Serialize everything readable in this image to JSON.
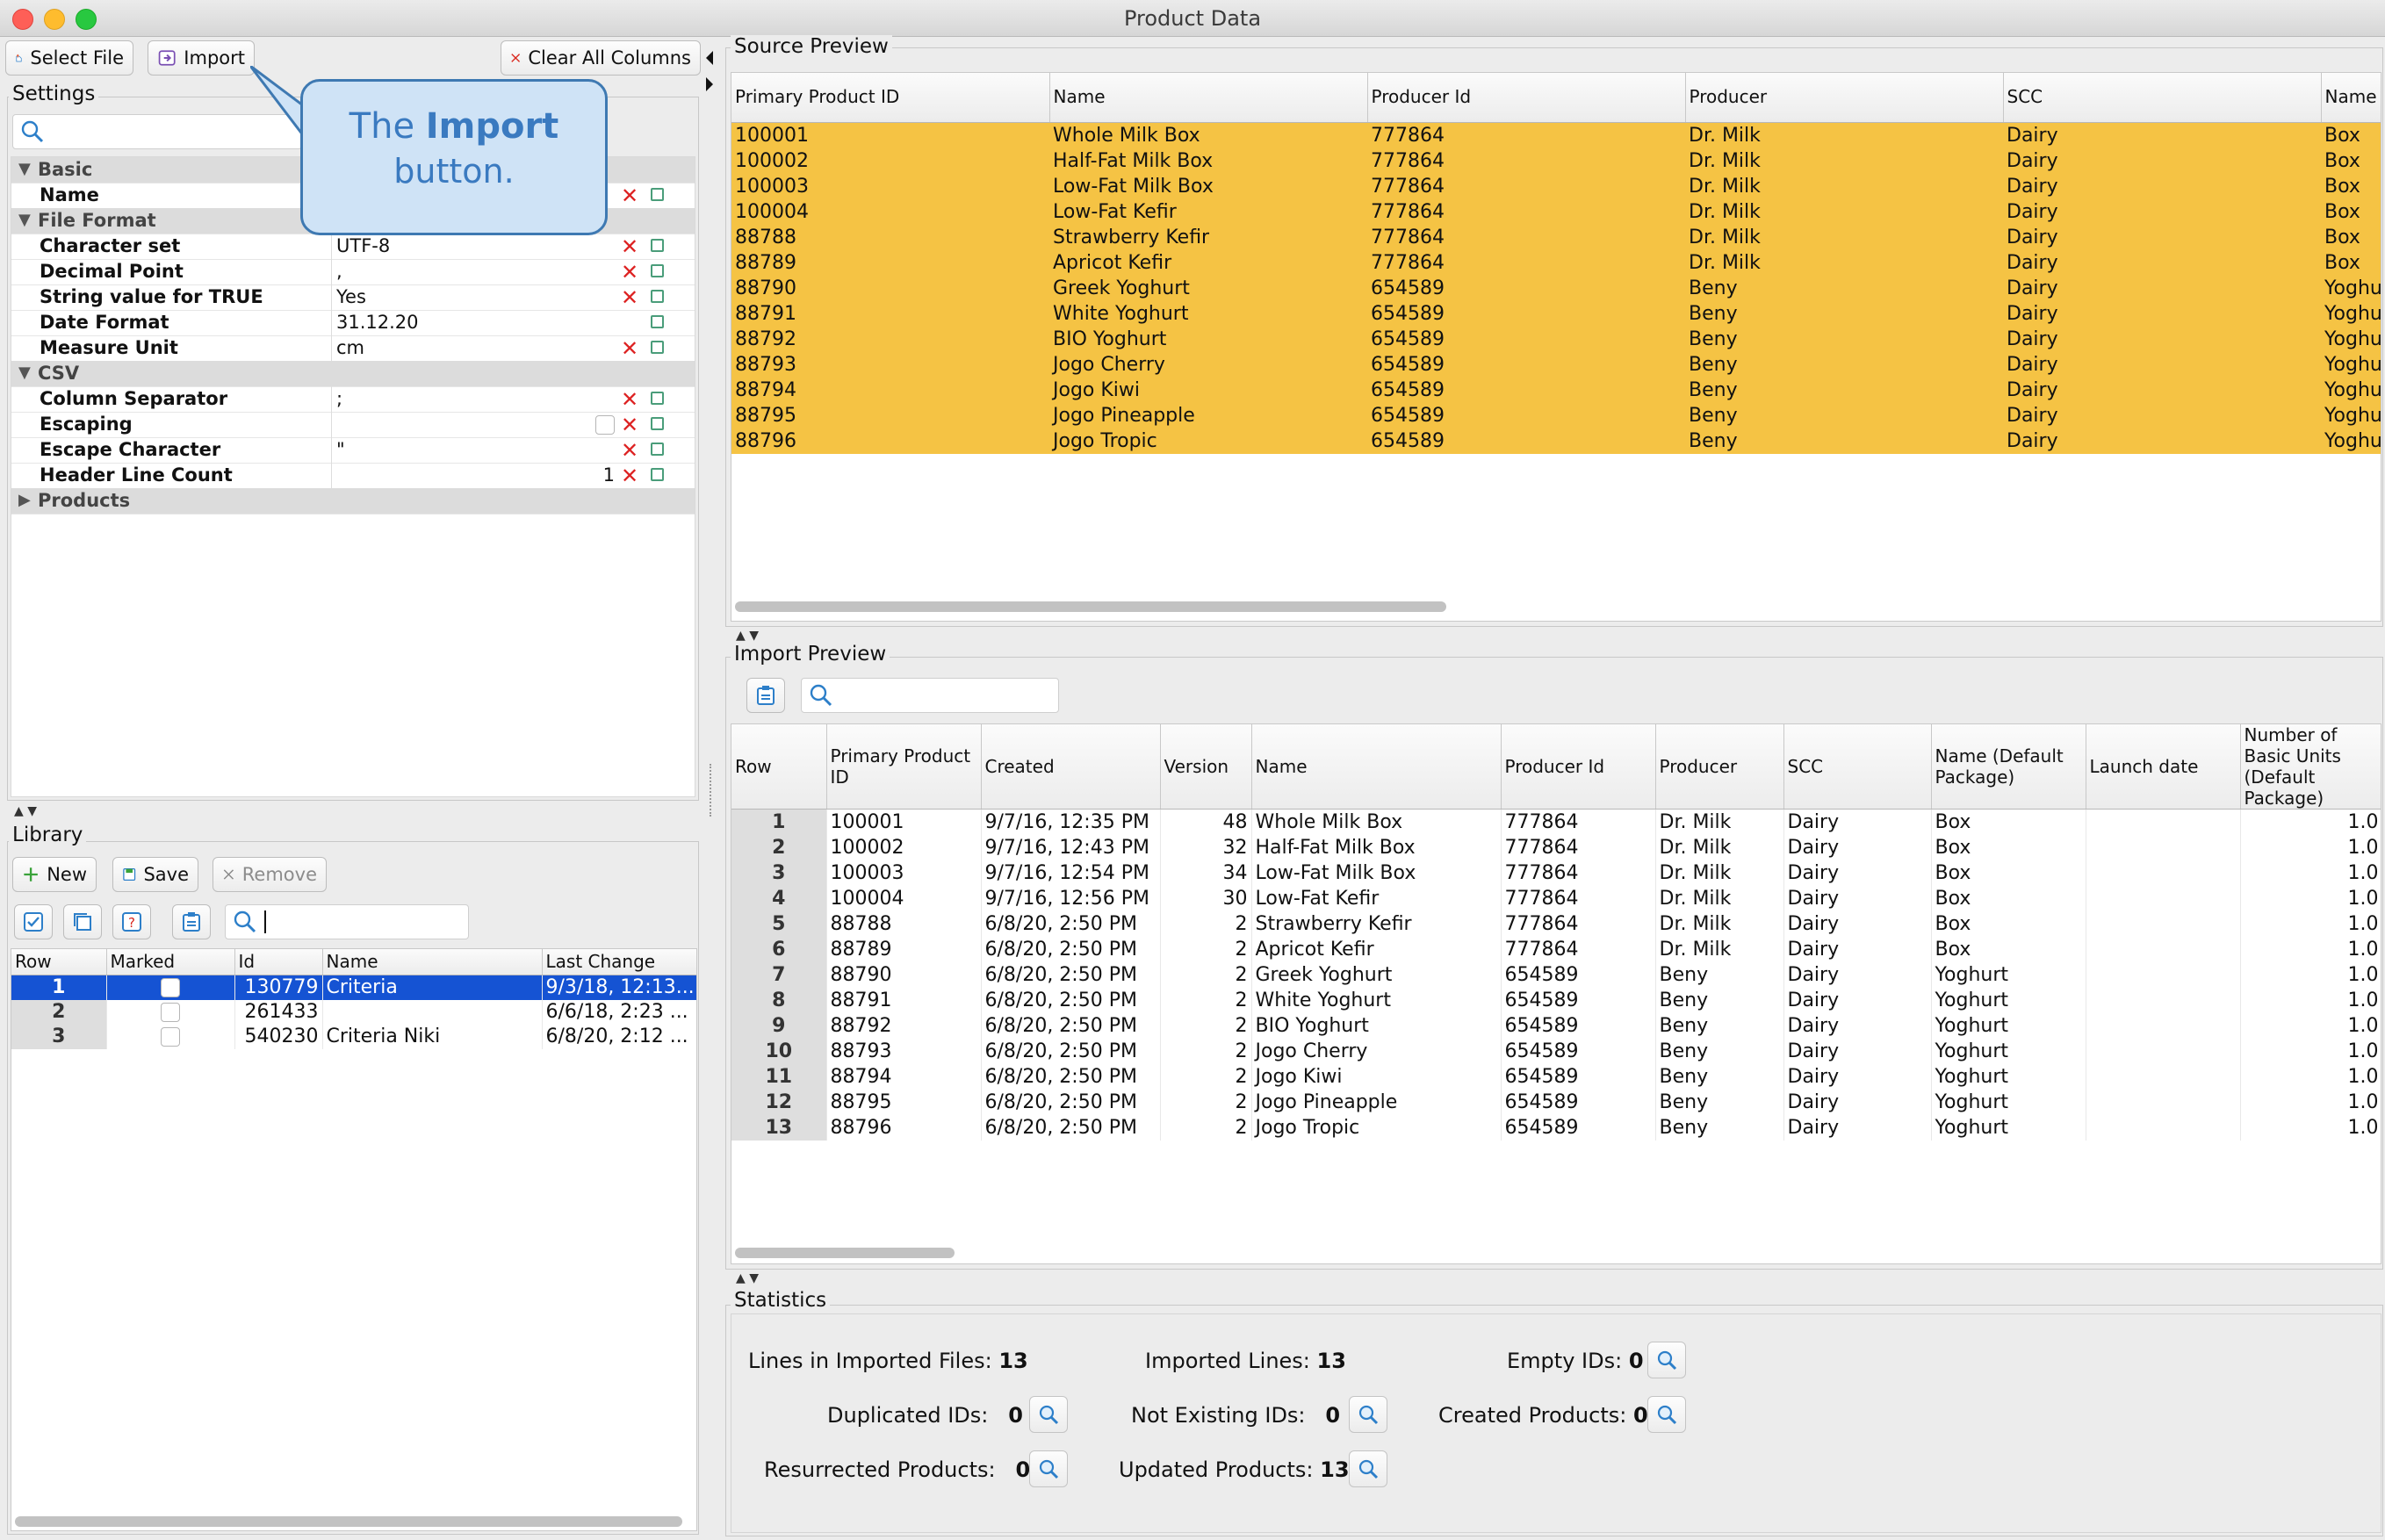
{
  "window": {
    "title": "Product Data"
  },
  "toolbar": {
    "select_file": "Select File",
    "import": "Import",
    "clear_all_columns": "Clear All Columns"
  },
  "settings": {
    "section_label": "Settings",
    "search_placeholder": "",
    "rows": [
      {
        "type": "group",
        "label": "Basic"
      },
      {
        "type": "prop",
        "label": "Name",
        "value": "",
        "clear": true
      },
      {
        "type": "group",
        "label": "File Format"
      },
      {
        "type": "prop",
        "label": "Character set",
        "value": "UTF-8",
        "clear": true
      },
      {
        "type": "prop",
        "label": "Decimal Point",
        "value": ",",
        "clear": true
      },
      {
        "type": "prop",
        "label": "String value for TRUE",
        "value": "Yes",
        "clear": true
      },
      {
        "type": "prop",
        "label": "Date Format",
        "value": "31.12.20",
        "clear": false
      },
      {
        "type": "prop",
        "label": "Measure Unit",
        "value": "cm",
        "clear": true
      },
      {
        "type": "group",
        "label": "CSV"
      },
      {
        "type": "prop",
        "label": "Column Separator",
        "value": ";",
        "clear": true
      },
      {
        "type": "prop",
        "label": "Escaping",
        "value": "",
        "checkbox": true,
        "clear": true
      },
      {
        "type": "prop",
        "label": "Escape Character",
        "value": "\"",
        "clear": true
      },
      {
        "type": "prop",
        "label": "Header Line Count",
        "value": "1",
        "align": "right",
        "clear": true
      },
      {
        "type": "group",
        "label": "Products",
        "collapsed": true
      }
    ]
  },
  "callout": {
    "prefix": "The ",
    "bold": "Import",
    "line2": "button."
  },
  "library": {
    "section_label": "Library",
    "new_label": "New",
    "save_label": "Save",
    "remove_label": "Remove",
    "search_value": "",
    "columns": [
      "Row",
      "Marked",
      "Id",
      "Name",
      "Last Change"
    ],
    "rows": [
      {
        "row": "1",
        "id": "130779",
        "name": "Criteria",
        "last_change": "9/3/18, 12:13...",
        "selected": true
      },
      {
        "row": "2",
        "id": "261433",
        "name": "",
        "last_change": "6/6/18, 2:23 ...",
        "selected": false
      },
      {
        "row": "3",
        "id": "540230",
        "name": "Criteria Niki",
        "last_change": "6/8/20, 2:12 ...",
        "selected": false
      }
    ]
  },
  "source_preview": {
    "section_label": "Source Preview",
    "highlight_color": "#f5c344",
    "columns": [
      "Primary Product ID",
      "Name",
      "Producer Id",
      "Producer",
      "SCC",
      "Name"
    ],
    "rows": [
      [
        "100001",
        "Whole Milk Box",
        "777864",
        "Dr. Milk",
        "Dairy",
        "Box"
      ],
      [
        "100002",
        "Half-Fat Milk Box",
        "777864",
        "Dr. Milk",
        "Dairy",
        "Box"
      ],
      [
        "100003",
        "Low-Fat Milk Box",
        "777864",
        "Dr. Milk",
        "Dairy",
        "Box"
      ],
      [
        "100004",
        "Low-Fat Kefir",
        "777864",
        "Dr. Milk",
        "Dairy",
        "Box"
      ],
      [
        "88788",
        "Strawberry Kefir",
        "777864",
        "Dr. Milk",
        "Dairy",
        "Box"
      ],
      [
        "88789",
        "Apricot Kefir",
        "777864",
        "Dr. Milk",
        "Dairy",
        "Box"
      ],
      [
        "88790",
        "Greek Yoghurt",
        "654589",
        "Beny",
        "Dairy",
        "Yoghu"
      ],
      [
        "88791",
        "White Yoghurt",
        "654589",
        "Beny",
        "Dairy",
        "Yoghu"
      ],
      [
        "88792",
        "BIO Yoghurt",
        "654589",
        "Beny",
        "Dairy",
        "Yoghu"
      ],
      [
        "88793",
        "Jogo Cherry",
        "654589",
        "Beny",
        "Dairy",
        "Yoghu"
      ],
      [
        "88794",
        "Jogo Kiwi",
        "654589",
        "Beny",
        "Dairy",
        "Yoghu"
      ],
      [
        "88795",
        "Jogo Pineapple",
        "654589",
        "Beny",
        "Dairy",
        "Yoghu"
      ],
      [
        "88796",
        "Jogo Tropic",
        "654589",
        "Beny",
        "Dairy",
        "Yoghu"
      ]
    ]
  },
  "import_preview": {
    "section_label": "Import Preview",
    "search_value": "",
    "columns": [
      "Row",
      "Primary Product ID",
      "Created",
      "Version",
      "Name",
      "Producer Id",
      "Producer",
      "SCC",
      "Name (Default Package)",
      "Launch date",
      "Number of Basic Units (Default Package)"
    ],
    "rows": [
      [
        "1",
        "100001",
        "9/7/16, 12:35 PM",
        "48",
        "Whole Milk Box",
        "777864",
        "Dr. Milk",
        "Dairy",
        "Box",
        "",
        "1.0"
      ],
      [
        "2",
        "100002",
        "9/7/16, 12:43 PM",
        "32",
        "Half-Fat Milk Box",
        "777864",
        "Dr. Milk",
        "Dairy",
        "Box",
        "",
        "1.0"
      ],
      [
        "3",
        "100003",
        "9/7/16, 12:54 PM",
        "34",
        "Low-Fat Milk Box",
        "777864",
        "Dr. Milk",
        "Dairy",
        "Box",
        "",
        "1.0"
      ],
      [
        "4",
        "100004",
        "9/7/16, 12:56 PM",
        "30",
        "Low-Fat Kefir",
        "777864",
        "Dr. Milk",
        "Dairy",
        "Box",
        "",
        "1.0"
      ],
      [
        "5",
        "88788",
        "6/8/20, 2:50 PM",
        "2",
        "Strawberry Kefir",
        "777864",
        "Dr. Milk",
        "Dairy",
        "Box",
        "",
        "1.0"
      ],
      [
        "6",
        "88789",
        "6/8/20, 2:50 PM",
        "2",
        "Apricot Kefir",
        "777864",
        "Dr. Milk",
        "Dairy",
        "Box",
        "",
        "1.0"
      ],
      [
        "7",
        "88790",
        "6/8/20, 2:50 PM",
        "2",
        "Greek Yoghurt",
        "654589",
        "Beny",
        "Dairy",
        "Yoghurt",
        "",
        "1.0"
      ],
      [
        "8",
        "88791",
        "6/8/20, 2:50 PM",
        "2",
        "White Yoghurt",
        "654589",
        "Beny",
        "Dairy",
        "Yoghurt",
        "",
        "1.0"
      ],
      [
        "9",
        "88792",
        "6/8/20, 2:50 PM",
        "2",
        "BIO Yoghurt",
        "654589",
        "Beny",
        "Dairy",
        "Yoghurt",
        "",
        "1.0"
      ],
      [
        "10",
        "88793",
        "6/8/20, 2:50 PM",
        "2",
        "Jogo Cherry",
        "654589",
        "Beny",
        "Dairy",
        "Yoghurt",
        "",
        "1.0"
      ],
      [
        "11",
        "88794",
        "6/8/20, 2:50 PM",
        "2",
        "Jogo Kiwi",
        "654589",
        "Beny",
        "Dairy",
        "Yoghurt",
        "",
        "1.0"
      ],
      [
        "12",
        "88795",
        "6/8/20, 2:50 PM",
        "2",
        "Jogo Pineapple",
        "654589",
        "Beny",
        "Dairy",
        "Yoghurt",
        "",
        "1.0"
      ],
      [
        "13",
        "88796",
        "6/8/20, 2:50 PM",
        "2",
        "Jogo Tropic",
        "654589",
        "Beny",
        "Dairy",
        "Yoghurt",
        "",
        "1.0"
      ]
    ]
  },
  "statistics": {
    "section_label": "Statistics",
    "lines_in_imported_files": {
      "label": "Lines in Imported Files:",
      "value": "13"
    },
    "imported_lines": {
      "label": "Imported Lines:",
      "value": "13"
    },
    "empty_ids": {
      "label": "Empty IDs:",
      "value": "0"
    },
    "duplicated_ids": {
      "label": "Duplicated IDs:",
      "value": "0"
    },
    "not_existing_ids": {
      "label": "Not Existing IDs:",
      "value": "0"
    },
    "created_products": {
      "label": "Created Products:",
      "value": "0"
    },
    "resurrected_products": {
      "label": "Resurrected Products:",
      "value": "0"
    },
    "updated_products": {
      "label": "Updated Products:",
      "value": "13"
    }
  }
}
